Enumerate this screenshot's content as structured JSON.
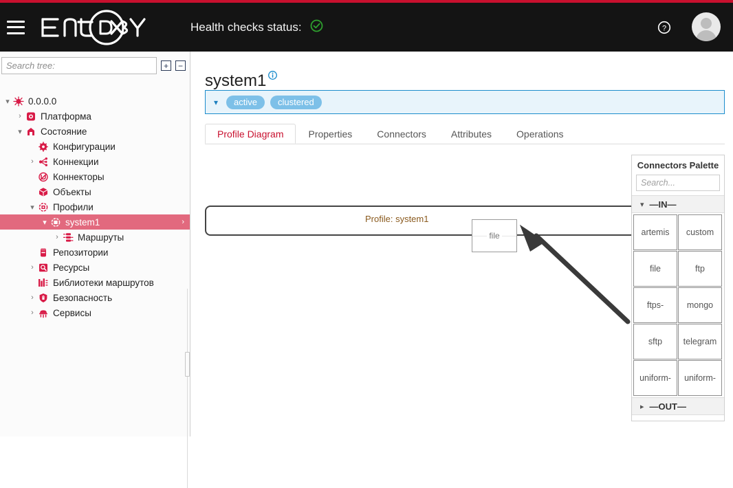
{
  "header": {
    "menu_icon": "hamburger-icon",
    "logo_text": "ENTAXY",
    "health_label": "Health checks status:",
    "health_state_icon": "check-circle-icon",
    "help_icon": "help-circle-icon",
    "avatar_icon": "user-avatar-icon",
    "accent_color": "#c8102e",
    "background_color": "#141414",
    "health_ok_color": "#2ea02e"
  },
  "sidebar": {
    "search_placeholder": "Search tree:",
    "search_value": "",
    "expand_all_icon": "expand-all-icon",
    "collapse_all_icon": "collapse-all-icon",
    "expand_all_label": "⊞",
    "collapse_all_label": "⊟",
    "selected_color": "#e2697e",
    "icon_color": "#d81b47",
    "tree": [
      {
        "label": "0.0.0.0",
        "icon": "host-icon",
        "indent": 0,
        "caret": "down",
        "selected": false
      },
      {
        "label": "Платформа",
        "icon": "platform-icon",
        "indent": 1,
        "caret": "right",
        "selected": false
      },
      {
        "label": "Состояние",
        "icon": "state-icon",
        "indent": 1,
        "caret": "down",
        "selected": false
      },
      {
        "label": "Конфигурации",
        "icon": "config-icon",
        "indent": 2,
        "caret": "none",
        "selected": false
      },
      {
        "label": "Коннекции",
        "icon": "connections-icon",
        "indent": 2,
        "caret": "right",
        "selected": false
      },
      {
        "label": "Коннекторы",
        "icon": "connectors-icon",
        "indent": 2,
        "caret": "none",
        "selected": false
      },
      {
        "label": "Объекты",
        "icon": "objects-icon",
        "indent": 2,
        "caret": "none",
        "selected": false
      },
      {
        "label": "Профили",
        "icon": "profiles-icon",
        "indent": 2,
        "caret": "down",
        "selected": false
      },
      {
        "label": "system1",
        "icon": "profile-icon",
        "indent": 3,
        "caret": "down",
        "selected": true,
        "right_caret": "›"
      },
      {
        "label": "Маршруты",
        "icon": "routes-icon",
        "indent": 4,
        "caret": "right",
        "selected": false
      },
      {
        "label": "Репозитории",
        "icon": "repositories-icon",
        "indent": 2,
        "caret": "none",
        "selected": false
      },
      {
        "label": "Ресурсы",
        "icon": "resources-icon",
        "indent": 2,
        "caret": "right",
        "selected": false
      },
      {
        "label": "Библиотеки маршрутов",
        "icon": "route-libraries-icon",
        "indent": 2,
        "caret": "none",
        "selected": false
      },
      {
        "label": "Безопасность",
        "icon": "security-icon",
        "indent": 2,
        "caret": "right",
        "selected": false
      },
      {
        "label": "Сервисы",
        "icon": "services-icon",
        "indent": 2,
        "caret": "right",
        "selected": false
      }
    ]
  },
  "main": {
    "page_title": "system1",
    "title_info_icon": "info-circle-icon",
    "status_caret_icon": "chevron-down-icon",
    "status_badges": [
      "active",
      "clustered"
    ],
    "status_border_color": "#1b8ccc",
    "status_background_color": "#e8f4fb",
    "badge_color": "#7dc0e8",
    "tabs": [
      {
        "label": "Profile Diagram",
        "active": true
      },
      {
        "label": "Properties",
        "active": false
      },
      {
        "label": "Connectors",
        "active": false
      },
      {
        "label": "Attributes",
        "active": false
      },
      {
        "label": "Operations",
        "active": false
      }
    ],
    "active_tab_color": "#c8102e",
    "diagram": {
      "profile_label": "Profile: system1",
      "profile_label_color": "#8a5a1e",
      "dropped_node_label": "file",
      "drag_arrow_icon": "drag-arrow-annotation"
    }
  },
  "palette": {
    "title": "Connectors Palette",
    "search_placeholder": "Search...",
    "search_value": "",
    "sections": [
      {
        "label": "—IN—",
        "expanded": true,
        "caret_icon": "chevron-down-icon",
        "items": [
          "artemis",
          "custom",
          "file",
          "ftp",
          "ftps-",
          "mongo",
          "sftp",
          "telegram",
          "uniform-",
          "uniform-"
        ]
      },
      {
        "label": "—OUT—",
        "expanded": false,
        "caret_icon": "chevron-right-icon",
        "items": []
      }
    ]
  }
}
